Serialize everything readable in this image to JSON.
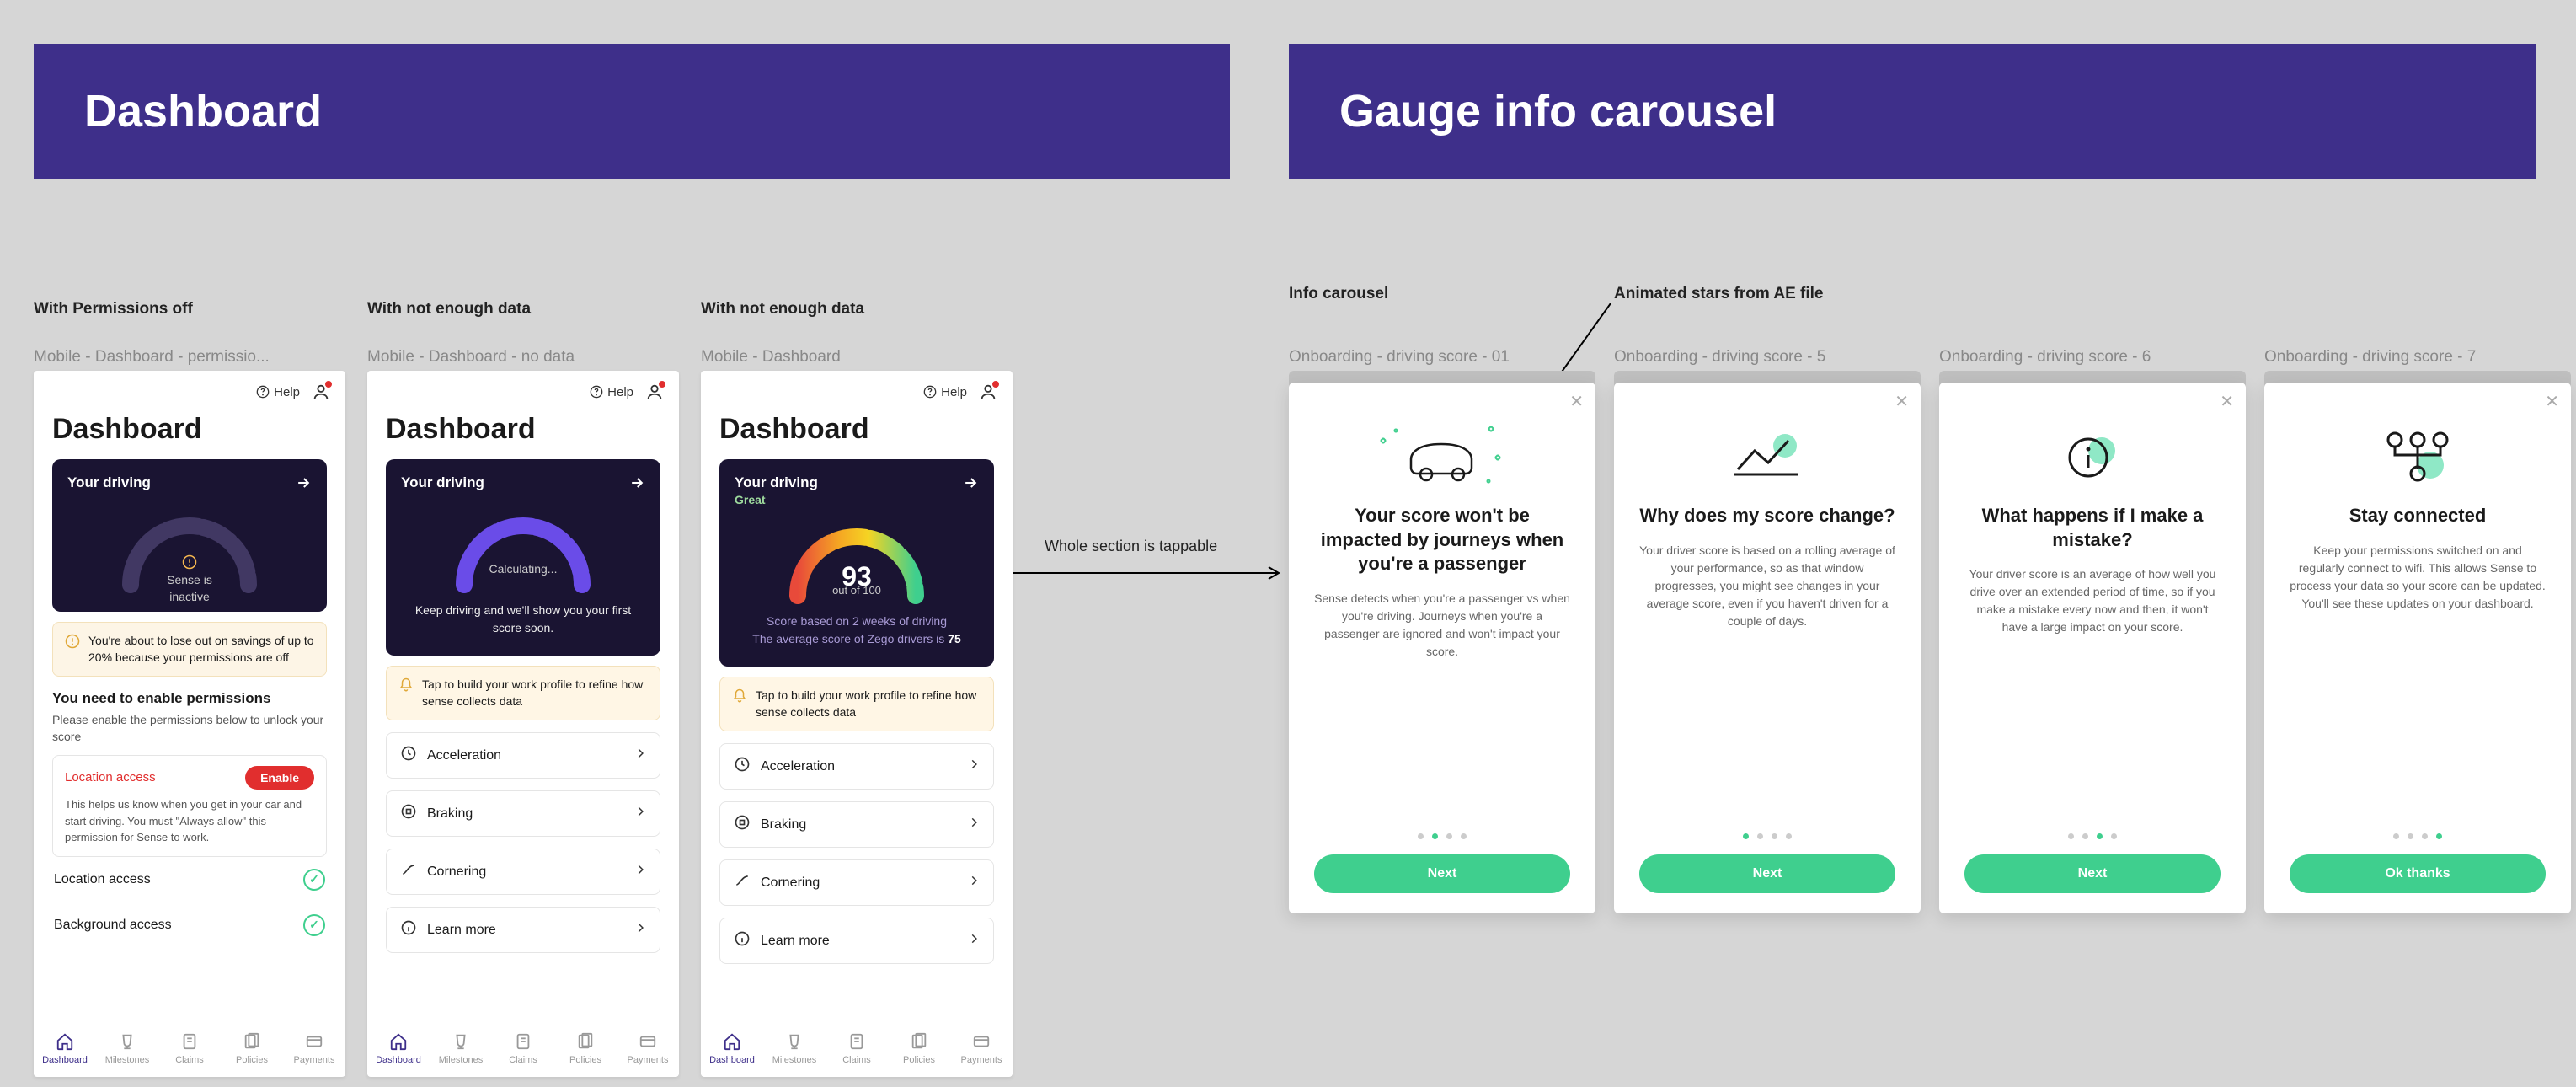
{
  "sections": {
    "dashboard": "Dashboard",
    "carousel": "Gauge info carousel"
  },
  "labels": {
    "perm_off": "With Permissions off",
    "not_enough_1": "With not enough data",
    "not_enough_2": "With not enough data",
    "info_carousel": "Info carousel",
    "animated_stars": "Animated stars from AE file"
  },
  "frameNames": {
    "f1": "Mobile - Dashboard - permissio...",
    "f2": "Mobile - Dashboard - no data",
    "f3": "Mobile - Dashboard",
    "c1": "Onboarding - driving score - 01",
    "c2": "Onboarding - driving score - 5",
    "c3": "Onboarding - driving score - 6",
    "c4": "Onboarding - driving score - 7"
  },
  "annotations": {
    "tappable": "Whole section is tappable"
  },
  "shared": {
    "help": "Help",
    "dash_title": "Dashboard",
    "your_driving": "Your driving"
  },
  "phone1": {
    "inactive_line1": "Sense is",
    "inactive_line2": "inactive",
    "notice": "You're about to lose out on savings of up to 20% because your permissions are off",
    "perm_h": "You need to enable permissions",
    "perm_p": "Please enable the permissions below to unlock your score",
    "loc_label": "Location access",
    "enable": "Enable",
    "loc_desc": "This helps us know when you get in your car and start driving. You must \"Always allow\" this permission for Sense to work.",
    "row1": "Location access",
    "row2": "Background access"
  },
  "phone2": {
    "calc": "Calculating...",
    "caption": "Keep driving and we'll show you your first score soon.",
    "notice": "Tap to build your work profile to refine how sense collects data"
  },
  "phone3": {
    "great": "Great",
    "score": "93",
    "out_of": "out of 100",
    "caption1": "Score based on 2 weeks of driving",
    "caption2_pre": "The average score of Zego drivers is ",
    "caption2_b": "75",
    "notice": "Tap to build your work profile to refine how sense collects data"
  },
  "metrics": [
    "Acceleration",
    "Braking",
    "Cornering",
    "Learn more"
  ],
  "tabs": [
    "Dashboard",
    "Milestones",
    "Claims",
    "Policies",
    "Payments"
  ],
  "cards": [
    {
      "title": "Your score won't be impacted by journeys when you're a passenger",
      "body": "Sense detects when you're a passenger vs when you're driving. Journeys when you're a passenger are ignored and won't impact your score.",
      "btn": "Next",
      "activeDot": 1
    },
    {
      "title": "Why does my score change?",
      "body": "Your driver score is based on a rolling average of your performance, so as that window progresses, you might see changes in your average score, even if you haven't driven for a couple of days.",
      "btn": "Next",
      "activeDot": 0
    },
    {
      "title": "What happens if I make a mistake?",
      "body": "Your driver score is an average of how well you drive over an extended period of time, so if you make a mistake every now and then, it won't have a large impact on your score.",
      "btn": "Next",
      "activeDot": 2
    },
    {
      "title": "Stay connected",
      "body": "Keep your permissions switched on and regularly connect to wifi. This allows Sense to process your data so your score can be updated. You'll see these updates on your dashboard.",
      "btn": "Ok thanks",
      "activeDot": 3
    }
  ]
}
